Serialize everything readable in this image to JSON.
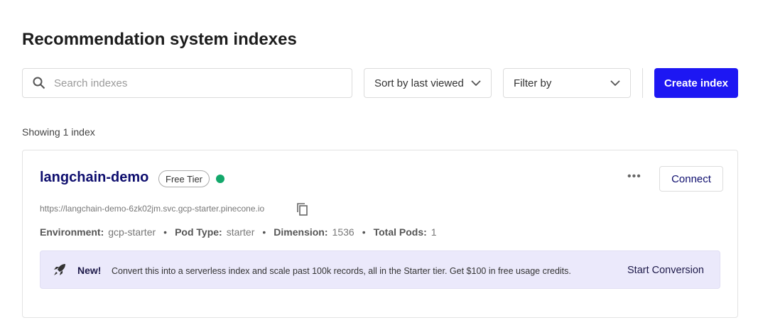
{
  "title": "Recommendation system indexes",
  "search": {
    "placeholder": "Search indexes"
  },
  "sort": {
    "label": "Sort by last viewed"
  },
  "filter": {
    "label": "Filter by"
  },
  "create_label": "Create index",
  "showing": "Showing 1 index",
  "index": {
    "name": "langchain-demo",
    "tier": "Free Tier",
    "status_color": "#13a86b",
    "url": "https://langchain-demo-6zk02jm.svc.gcp-starter.pinecone.io",
    "connect_label": "Connect",
    "more_label": "•••",
    "meta": [
      {
        "label": "Environment:",
        "value": "gcp-starter"
      },
      {
        "label": "Pod Type:",
        "value": "starter"
      },
      {
        "label": "Dimension:",
        "value": "1536"
      },
      {
        "label": "Total Pods:",
        "value": "1"
      }
    ],
    "separator": "•",
    "banner": {
      "new": "New!",
      "message": "Convert this into a serverless index and scale past 100k records, all in the Starter tier. Get $100 in free usage credits.",
      "action": "Start Conversion"
    }
  }
}
